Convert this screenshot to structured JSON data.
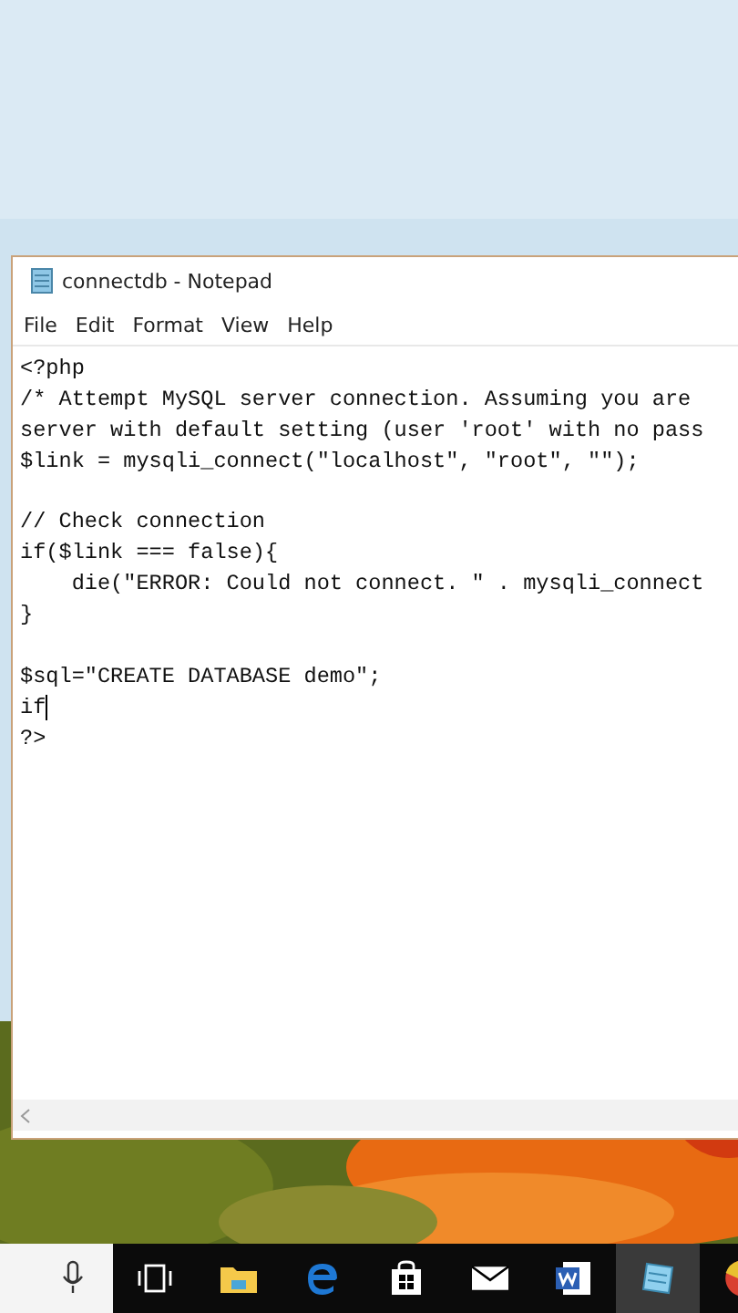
{
  "window": {
    "title": "connectdb - Notepad"
  },
  "menu": [
    "File",
    "Edit",
    "Format",
    "View",
    "Help"
  ],
  "editor": {
    "lines": [
      {
        "text": "<?php",
        "caret": false
      },
      {
        "text": "/* Attempt MySQL server connection. Assuming you are",
        "caret": false
      },
      {
        "text": "server with default setting (user 'root' with no pass",
        "caret": false
      },
      {
        "text": "$link = mysqli_connect(\"localhost\", \"root\", \"\");",
        "caret": false
      },
      {
        "caret": false
      },
      {
        "text": "// Check connection",
        "caret": false
      },
      {
        "text": "if($link === false){",
        "caret": false
      },
      {
        "text": "    die(\"ERROR: Could not connect. \" . mysqli_connect",
        "caret": false
      },
      {
        "text": "}",
        "caret": false
      },
      {
        "caret": false
      },
      {
        "text": "$sql=\"CREATE DATABASE demo\";",
        "caret": false
      },
      {
        "text": "if",
        "caret": true
      },
      {
        "text": "?>",
        "caret": false
      }
    ]
  },
  "taskbar": {
    "apps": [
      {
        "kind": "mic",
        "selected": false
      },
      {
        "kind": "taskview",
        "selected": false
      },
      {
        "kind": "folder",
        "selected": false
      },
      {
        "kind": "browser",
        "selected": false
      },
      {
        "kind": "store",
        "selected": false
      },
      {
        "kind": "mail",
        "selected": false
      },
      {
        "kind": "document",
        "selected": false
      },
      {
        "kind": "notepad",
        "selected": true
      },
      {
        "kind": "globe",
        "selected": false
      }
    ]
  }
}
